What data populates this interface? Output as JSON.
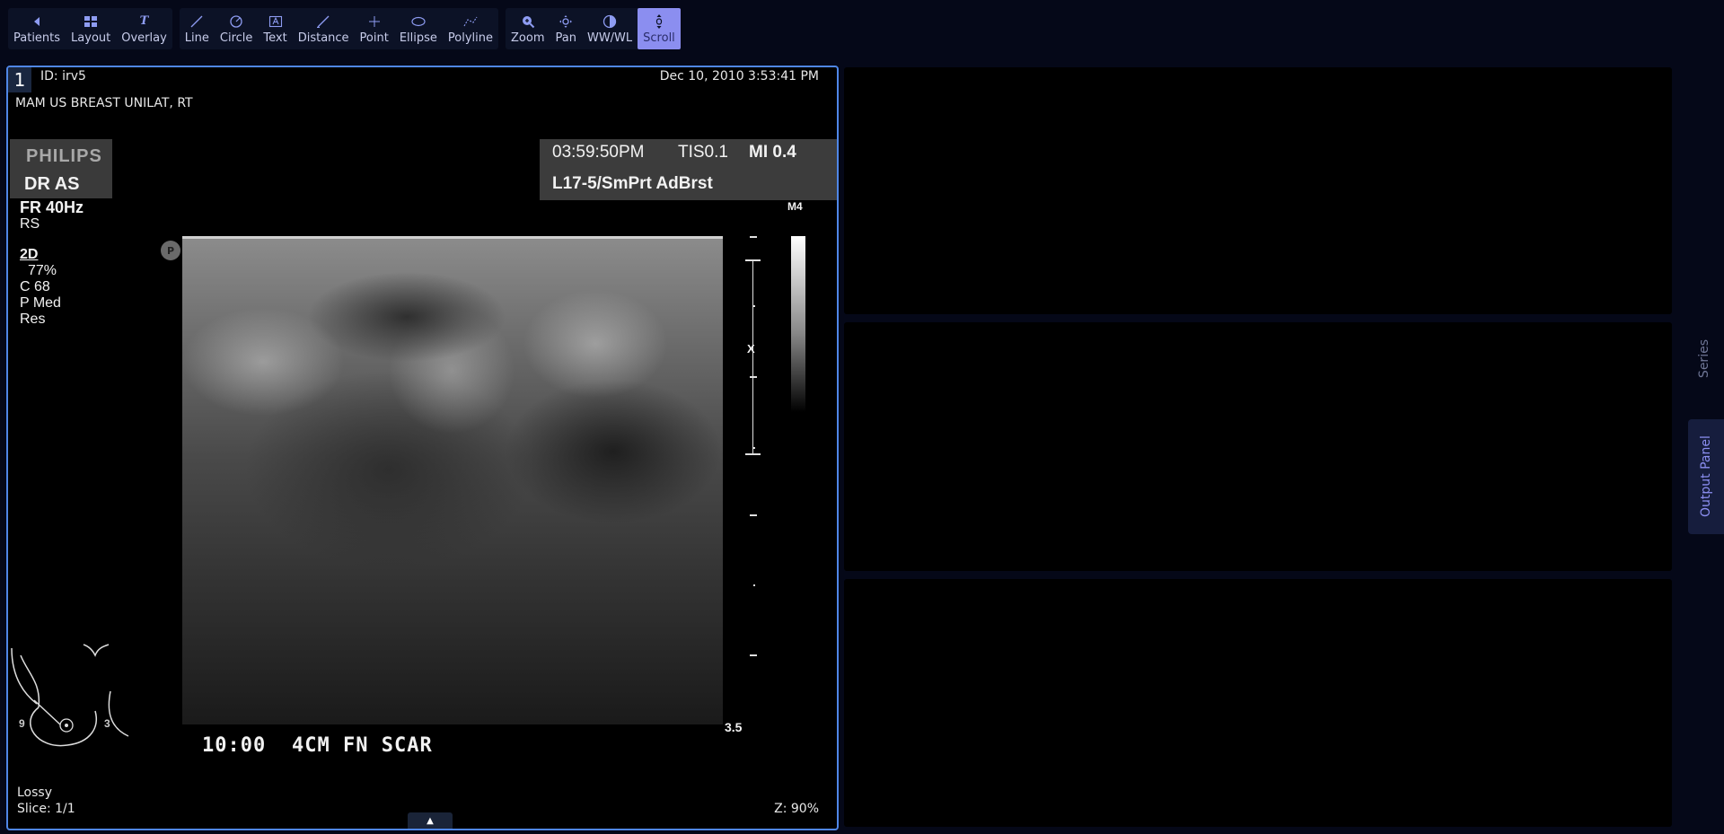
{
  "toolbar": {
    "group1": [
      {
        "label": "Patients",
        "icon": "chevron-left-icon"
      },
      {
        "label": "Layout",
        "icon": "grid-icon"
      },
      {
        "label": "Overlay",
        "icon": "text-italic-icon"
      }
    ],
    "group2": [
      {
        "label": "Line",
        "icon": "line-icon"
      },
      {
        "label": "Circle",
        "icon": "circle-icon"
      },
      {
        "label": "Text",
        "icon": "text-box-icon"
      },
      {
        "label": "Distance",
        "icon": "distance-icon"
      },
      {
        "label": "Point",
        "icon": "point-icon"
      },
      {
        "label": "Ellipse",
        "icon": "ellipse-icon"
      },
      {
        "label": "Polyline",
        "icon": "polyline-icon"
      }
    ],
    "group3": [
      {
        "label": "Zoom",
        "icon": "zoom-icon"
      },
      {
        "label": "Pan",
        "icon": "pan-icon"
      },
      {
        "label": "WW/WL",
        "icon": "contrast-icon"
      },
      {
        "label": "Scroll",
        "icon": "scroll-icon",
        "active": true
      }
    ]
  },
  "viewport": {
    "index": "1",
    "patient_id": "ID: irv5",
    "datetime": "Dec 10, 2010 3:53:41 PM",
    "study": "MAM US BREAST UNILAT, RT",
    "compression": "Lossy",
    "slice": "Slice: 1/1",
    "zoom": "Z: 90%"
  },
  "ultrasound": {
    "brand": "PHILIPS",
    "operator": "DR AS",
    "frame_rate": "FR 40Hz",
    "rs": "RS",
    "mode": "2D",
    "gain": "77%",
    "compression": "C 68",
    "persistence": "P Med",
    "resolution": "Res",
    "time": "03:59:50PM",
    "tis": "TIS0.1",
    "mi": "MI 0.4",
    "probe": "L17-5/SmPrt AdBrst",
    "map": "M4",
    "depth": "3.5",
    "annotation_clock": "10:00",
    "annotation_text": "4CM FN SCAR",
    "focus_marker": "X",
    "probe_orientation": "P",
    "bodymark_left": "9",
    "bodymark_right": "3"
  },
  "side_tabs": {
    "series": "Series",
    "output_panel": "Output Panel"
  },
  "colors": {
    "background": "#050818",
    "accent": "#8b8ef0",
    "viewport_border": "#4f86e6"
  }
}
